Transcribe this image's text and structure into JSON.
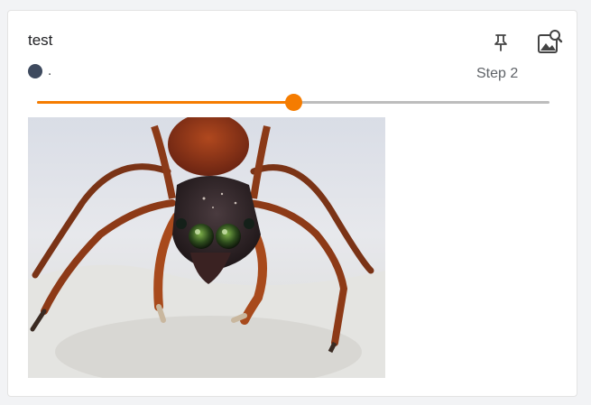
{
  "card": {
    "title": "test",
    "run_name": ".",
    "run_color": "#3e4a5e",
    "step_label": "Step 2"
  },
  "slider": {
    "value_fraction": 0.5,
    "accent_color": "#f57c00"
  },
  "icons": {
    "pin": "pin-icon",
    "image_search": "image-search-icon"
  }
}
